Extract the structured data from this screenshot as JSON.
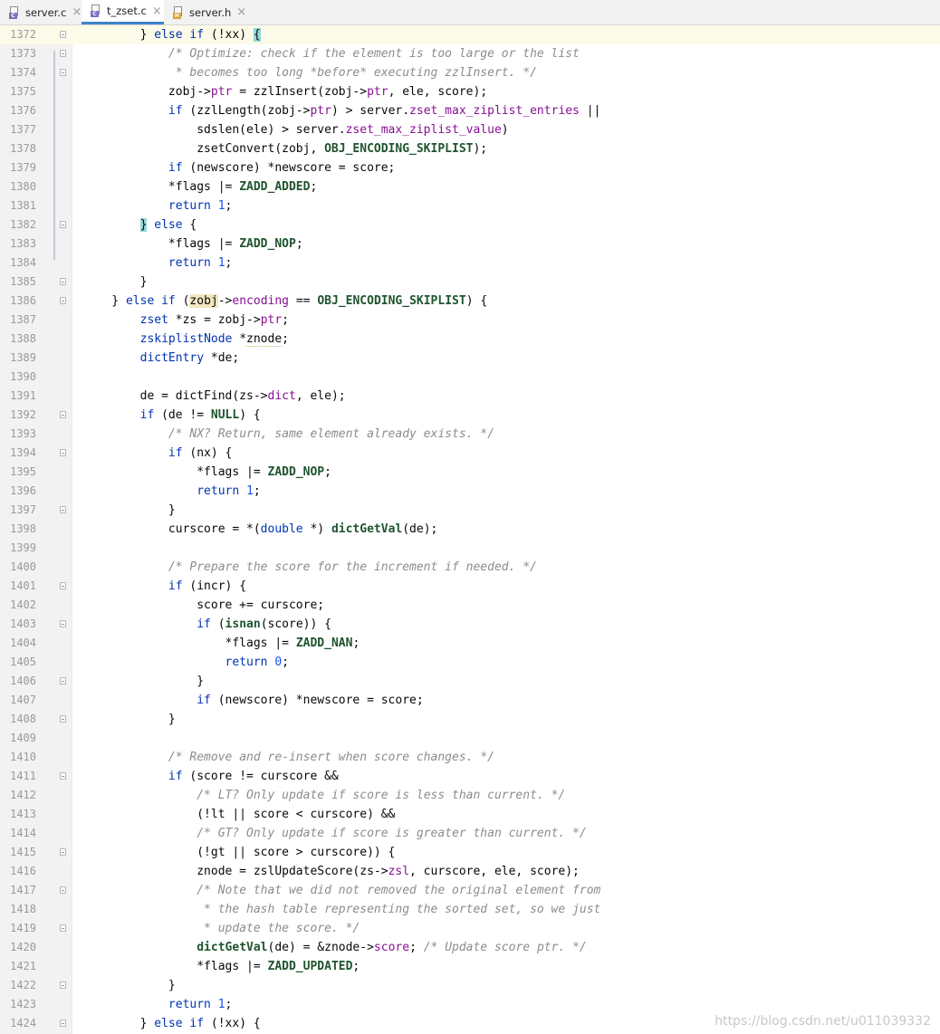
{
  "tabs": [
    {
      "label": "server.c",
      "type": "c",
      "active": false
    },
    {
      "label": "t_zset.c",
      "type": "c",
      "active": true
    },
    {
      "label": "server.h",
      "type": "h",
      "active": false
    }
  ],
  "watermark": "https://blog.csdn.net/u011039332",
  "code_lines": [
    {
      "n": "1372",
      "fold": "open",
      "caret": true,
      "html": "        } <span class=\"kw\">else if</span> (!xx) <span class=\"bm\">{</span>"
    },
    {
      "n": "1373",
      "fold": "open",
      "html": "            <span class=\"cm\">/* Optimize: check if the element is too large or the list</span>"
    },
    {
      "n": "1374",
      "fold": "open",
      "html": "<span class=\"cm\">             * becomes too long *before* executing zzlInsert. */</span>"
    },
    {
      "n": "1375",
      "html": "            zobj-&gt;<span class=\"fld\">ptr</span> = zzlInsert(zobj-&gt;<span class=\"fld\">ptr</span>, ele, score);"
    },
    {
      "n": "1376",
      "html": "            <span class=\"kw\">if</span> (zzlLength(zobj-&gt;<span class=\"fld\">ptr</span>) &gt; server.<span class=\"fld\">zset_max_ziplist_entries</span> ||"
    },
    {
      "n": "1377",
      "html": "                sdslen(ele) &gt; server.<span class=\"fld\">zset_max_ziplist_value</span>)"
    },
    {
      "n": "1378",
      "html": "                zsetConvert(zobj, <span class=\"mac\">OBJ_ENCODING_SKIPLIST</span>);"
    },
    {
      "n": "1379",
      "html": "            <span class=\"kw\">if</span> (newscore) *newscore = score;"
    },
    {
      "n": "1380",
      "html": "            *flags |= <span class=\"mac\">ZADD_ADDED</span>;"
    },
    {
      "n": "1381",
      "html": "            <span class=\"kw\">return</span> <span class=\"num\">1</span>;"
    },
    {
      "n": "1382",
      "fold": "open",
      "html": "        <span class=\"bm\">}</span> <span class=\"kw\">else</span> {"
    },
    {
      "n": "1383",
      "html": "            *flags |= <span class=\"mac\">ZADD_NOP</span>;"
    },
    {
      "n": "1384",
      "html": "            <span class=\"kw\">return</span> <span class=\"num\">1</span>;"
    },
    {
      "n": "1385",
      "fold": "open",
      "html": "        }"
    },
    {
      "n": "1386",
      "fold": "open",
      "html": "    } <span class=\"kw\">else if</span> (<span class=\"hl\">zobj</span>-&gt;<span class=\"fld\">encoding</span> == <span class=\"mac\">OBJ_ENCODING_SKIPLIST</span>) {"
    },
    {
      "n": "1387",
      "html": "        <span class=\"typ\">zset</span> *zs = zobj-&gt;<span class=\"fld\">ptr</span>;"
    },
    {
      "n": "1388",
      "html": "        <span class=\"typ\">zskiplistNode</span> *<span class=\"warn\">znode</span>;"
    },
    {
      "n": "1389",
      "html": "        <span class=\"typ\">dictEntry</span> *de;"
    },
    {
      "n": "1390",
      "html": ""
    },
    {
      "n": "1391",
      "html": "        de = dictFind(zs-&gt;<span class=\"fld\">dict</span>, ele);"
    },
    {
      "n": "1392",
      "fold": "open",
      "html": "        <span class=\"kw\">if</span> (de != <span class=\"mac\">NULL</span>) {"
    },
    {
      "n": "1393",
      "html": "            <span class=\"cm\">/* NX? Return, same element already exists. */</span>"
    },
    {
      "n": "1394",
      "fold": "open",
      "html": "            <span class=\"kw\">if</span> (nx) {"
    },
    {
      "n": "1395",
      "html": "                *flags |= <span class=\"mac\">ZADD_NOP</span>;"
    },
    {
      "n": "1396",
      "html": "                <span class=\"kw\">return</span> <span class=\"num\">1</span>;"
    },
    {
      "n": "1397",
      "fold": "open",
      "html": "            }"
    },
    {
      "n": "1398",
      "html": "            curscore = *(<span class=\"kw\">double</span> *) <span class=\"mac\">dictGetVal</span>(de);"
    },
    {
      "n": "1399",
      "html": ""
    },
    {
      "n": "1400",
      "html": "            <span class=\"cm\">/* Prepare the score for the increment if needed. */</span>"
    },
    {
      "n": "1401",
      "fold": "open",
      "html": "            <span class=\"kw\">if</span> (incr) {"
    },
    {
      "n": "1402",
      "html": "                score += curscore;"
    },
    {
      "n": "1403",
      "fold": "open",
      "html": "                <span class=\"kw\">if</span> (<span class=\"mac\">isnan</span>(score)) {"
    },
    {
      "n": "1404",
      "html": "                    *flags |= <span class=\"mac\">ZADD_NAN</span>;"
    },
    {
      "n": "1405",
      "html": "                    <span class=\"kw\">return</span> <span class=\"num\">0</span>;"
    },
    {
      "n": "1406",
      "fold": "open",
      "html": "                }"
    },
    {
      "n": "1407",
      "html": "                <span class=\"kw\">if</span> (newscore) *newscore = score;"
    },
    {
      "n": "1408",
      "fold": "open",
      "html": "            }"
    },
    {
      "n": "1409",
      "html": ""
    },
    {
      "n": "1410",
      "html": "            <span class=\"cm\">/* Remove and re-insert when score changes. */</span>"
    },
    {
      "n": "1411",
      "fold": "open",
      "html": "            <span class=\"kw\">if</span> (score != curscore &amp;&amp;"
    },
    {
      "n": "1412",
      "html": "                <span class=\"cm\">/* LT? Only update if score is less than current. */</span>"
    },
    {
      "n": "1413",
      "html": "                (!lt || score &lt; curscore) &amp;&amp;"
    },
    {
      "n": "1414",
      "html": "                <span class=\"cm\">/* GT? Only update if score is greater than current. */</span>"
    },
    {
      "n": "1415",
      "fold": "open",
      "html": "                (!gt || score &gt; curscore)) {"
    },
    {
      "n": "1416",
      "html": "                znode = zslUpdateScore(zs-&gt;<span class=\"fld\">zsl</span>, curscore, ele, score);"
    },
    {
      "n": "1417",
      "fold": "open",
      "html": "                <span class=\"cm\">/* Note that we did not removed the original element from</span>"
    },
    {
      "n": "1418",
      "html": "<span class=\"cm\">                 * the hash table representing the sorted set, so we just</span>"
    },
    {
      "n": "1419",
      "fold": "open",
      "html": "<span class=\"cm\">                 * update the score. */</span>"
    },
    {
      "n": "1420",
      "html": "                <span class=\"mac\">dictGetVal</span>(de) = &amp;znode-&gt;<span class=\"fld\">score</span>; <span class=\"cm\">/* Update score ptr. */</span>"
    },
    {
      "n": "1421",
      "html": "                *flags |= <span class=\"mac\">ZADD_UPDATED</span>;"
    },
    {
      "n": "1422",
      "fold": "open",
      "html": "            }"
    },
    {
      "n": "1423",
      "html": "            <span class=\"kw\">return</span> <span class=\"num\">1</span>;"
    },
    {
      "n": "1424",
      "fold": "open",
      "html": "        } <span class=\"kw\">else if</span> (!xx) {"
    }
  ]
}
